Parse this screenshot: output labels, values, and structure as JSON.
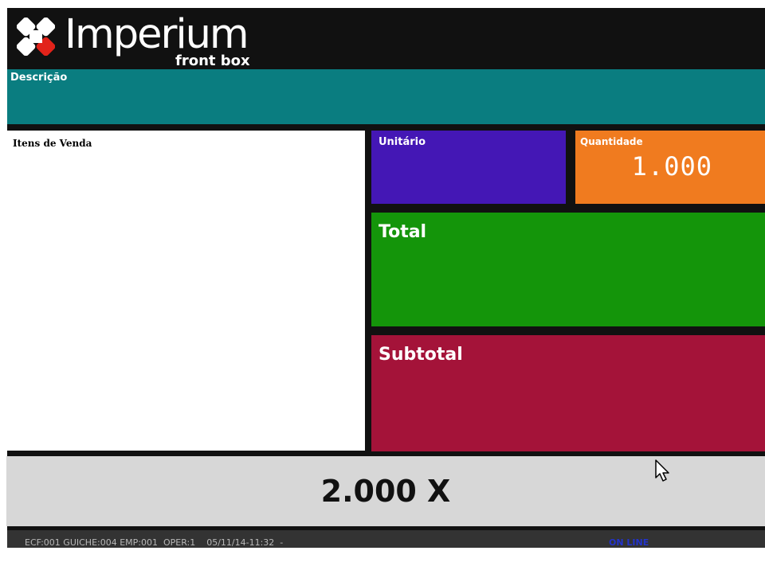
{
  "brand": {
    "name": "Imperium",
    "subtitle": "front box",
    "logo_icon": "four-squares-logo-icon"
  },
  "panels": {
    "descricao": {
      "label": "Descrição",
      "value": ""
    },
    "itens": {
      "label": "Itens de Venda"
    },
    "unitario": {
      "label": "Unitário",
      "value": ""
    },
    "quantidade": {
      "label": "Quantidade",
      "value": "1.000"
    },
    "total": {
      "label": "Total",
      "value": ""
    },
    "subtotal": {
      "label": "Subtotal",
      "value": ""
    }
  },
  "multiplier": {
    "value": "2.000 X"
  },
  "status_bar": {
    "info": "ECF:001 GUICHE:004 EMP:001  OPER:1    05/11/14-11:32  -",
    "connection": "ON LINE"
  },
  "colors": {
    "descricao": "#0a7d80",
    "unitario": "#4417b5",
    "quantidade": "#f07b1f",
    "total": "#14950a",
    "subtotal": "#a41339",
    "multiplier": "#d7d7d7",
    "logo_red": "#e2231a"
  }
}
